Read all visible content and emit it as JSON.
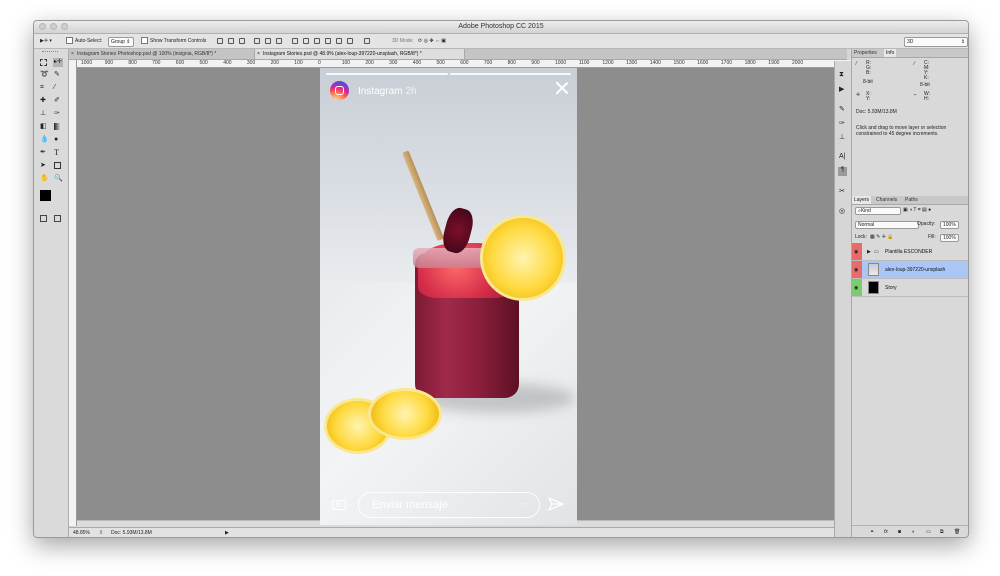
{
  "window": {
    "title": "Adobe Photoshop CC 2015"
  },
  "options_bar": {
    "auto_select_label": "Auto-Select:",
    "auto_select_value": "Group",
    "show_transform_label": "Show Transform Controls",
    "mode_3d_label": "3D Mode:",
    "workspace_value": "3D"
  },
  "doc_tabs": [
    {
      "label": "Instagram Stories Photoshop.psd @ 100% (insignia, RGB/8*) *"
    },
    {
      "label": "Instagram Stories.psd @ 48.9% (alex-loup-397220-unsplash, RGB/8*) *"
    }
  ],
  "ruler_labels": [
    "1000",
    "900",
    "800",
    "700",
    "600",
    "500",
    "400",
    "300",
    "200",
    "100",
    "0",
    "100",
    "200",
    "300",
    "400",
    "500",
    "600",
    "700",
    "800",
    "900",
    "1000",
    "1100",
    "1200",
    "1300",
    "1400",
    "1500",
    "1600",
    "1700",
    "1800",
    "1900",
    "2000"
  ],
  "status_bar": {
    "zoom": "48.85%",
    "doc": "Doc: 5.93M/13.8M"
  },
  "properties_panel": {
    "tabs": [
      "Properties",
      "Info"
    ],
    "r_label": "R:",
    "g_label": "G:",
    "b_label": "B:",
    "c_label": "C:",
    "m_label": "M:",
    "y_label": "Y:",
    "k_label": "K:",
    "bit_left": "8-bit",
    "bit_right": "8-bit",
    "x_label": "X:",
    "y2_label": "Y:",
    "w_label": "W:",
    "h_label": "H:",
    "doc": "Doc: 5.93M/13.8M",
    "hint": "Click and drag to move layer or selection constrained to 45 degree increments."
  },
  "layers_panel": {
    "tabs": [
      "Layers",
      "Channels",
      "Paths"
    ],
    "kind_value": "Kind",
    "blend_mode": "Normal",
    "opacity_label": "Opacity:",
    "opacity_value": "100%",
    "lock_label": "Lock:",
    "fill_label": "Fill:",
    "fill_value": "100%",
    "layers": [
      {
        "name": "Plantilla ESCONDER",
        "eye_color": "#e86b6b",
        "type": "group"
      },
      {
        "name": "alex-loup-397220-unsplash",
        "eye_color": "#e86b6b",
        "type": "image",
        "selected": true
      },
      {
        "name": "Story",
        "eye_color": "#7bcc6e",
        "type": "fill"
      }
    ],
    "footer_icons": [
      "link-icon",
      "fx-icon",
      "mask-icon",
      "adjustment-icon",
      "folder-icon",
      "new-layer-icon",
      "trash-icon"
    ]
  },
  "story": {
    "account": "Instagram",
    "time": "2h",
    "message_placeholder": "Enviar mensaje",
    "dots": "···"
  },
  "colors": {
    "canvas": "#8d8d8d",
    "selected_layer": "#a9c6f5",
    "foreground": "#000000",
    "background": "#ffffff"
  }
}
